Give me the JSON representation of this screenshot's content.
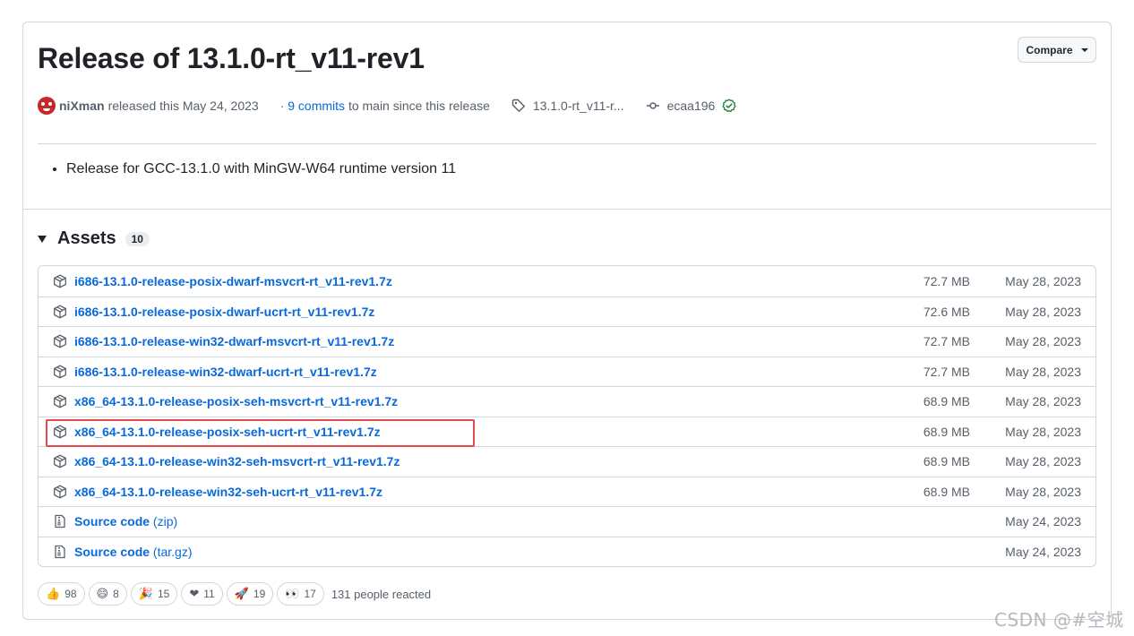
{
  "release": {
    "title": "Release of 13.1.0-rt_v11-rev1",
    "compare_label": "Compare",
    "author": "niXman",
    "released_text": "released this May 24, 2023",
    "commits_prefix": "·",
    "commits_link": "9 commits",
    "commits_suffix": "to main since this release",
    "tag": "13.1.0-rt_v11-r...",
    "commit_hash": "ecaa196",
    "notes": [
      "Release for GCC-13.1.0 with MinGW-W64 runtime version 11"
    ]
  },
  "assets": {
    "title": "Assets",
    "count": "10",
    "items": [
      {
        "name": "i686-13.1.0-release-posix-dwarf-msvcrt-rt_v11-rev1.7z",
        "size": "72.7 MB",
        "date": "May 28, 2023",
        "kind": "package-icon"
      },
      {
        "name": "i686-13.1.0-release-posix-dwarf-ucrt-rt_v11-rev1.7z",
        "size": "72.6 MB",
        "date": "May 28, 2023",
        "kind": "package-icon"
      },
      {
        "name": "i686-13.1.0-release-win32-dwarf-msvcrt-rt_v11-rev1.7z",
        "size": "72.7 MB",
        "date": "May 28, 2023",
        "kind": "package-icon"
      },
      {
        "name": "i686-13.1.0-release-win32-dwarf-ucrt-rt_v11-rev1.7z",
        "size": "72.7 MB",
        "date": "May 28, 2023",
        "kind": "package-icon"
      },
      {
        "name": "x86_64-13.1.0-release-posix-seh-msvcrt-rt_v11-rev1.7z",
        "size": "68.9 MB",
        "date": "May 28, 2023",
        "kind": "package-icon"
      },
      {
        "name": "x86_64-13.1.0-release-posix-seh-ucrt-rt_v11-rev1.7z",
        "size": "68.9 MB",
        "date": "May 28, 2023",
        "kind": "package-icon"
      },
      {
        "name": "x86_64-13.1.0-release-win32-seh-msvcrt-rt_v11-rev1.7z",
        "size": "68.9 MB",
        "date": "May 28, 2023",
        "kind": "package-icon"
      },
      {
        "name": "x86_64-13.1.0-release-win32-seh-ucrt-rt_v11-rev1.7z",
        "size": "68.9 MB",
        "date": "May 28, 2023",
        "kind": "package-icon"
      },
      {
        "name": "Source code",
        "ext": "(zip)",
        "size": "",
        "date": "May 24, 2023",
        "kind": "file-zip-icon"
      },
      {
        "name": "Source code",
        "ext": "(tar.gz)",
        "size": "",
        "date": "May 24, 2023",
        "kind": "file-zip-icon"
      }
    ]
  },
  "reactions": {
    "items": [
      {
        "emoji": "👍",
        "count": "98",
        "icon": "thumbs-up-icon"
      },
      {
        "emoji": "😄",
        "count": "8",
        "icon": "laugh-icon"
      },
      {
        "emoji": "🎉",
        "count": "15",
        "icon": "hooray-icon"
      },
      {
        "emoji": "❤",
        "count": "11",
        "icon": "heart-icon"
      },
      {
        "emoji": "🚀",
        "count": "19",
        "icon": "rocket-icon"
      },
      {
        "emoji": "👀",
        "count": "17",
        "icon": "eyes-icon"
      }
    ],
    "summary": "131 people reacted"
  },
  "watermark": "CSDN @#空城",
  "colors": {
    "link": "#0969da",
    "highlight": "#e5484d",
    "verified": "#1a7f37"
  }
}
